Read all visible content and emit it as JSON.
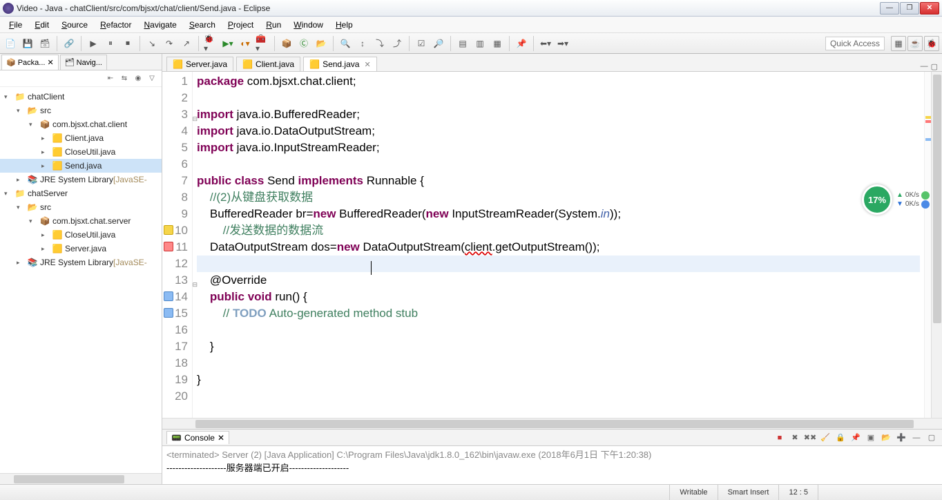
{
  "title": "Video - Java - chatClient/src/com/bjsxt/chat/client/Send.java - Eclipse",
  "menu": [
    "File",
    "Edit",
    "Source",
    "Refactor",
    "Navigate",
    "Search",
    "Project",
    "Run",
    "Window",
    "Help"
  ],
  "quick_access": "Quick Access",
  "sidebar": {
    "tabs": [
      {
        "label": "Packa...",
        "active": true
      },
      {
        "label": "Navig..."
      }
    ],
    "tree": [
      {
        "depth": 0,
        "exp": "▾",
        "icon": "proj",
        "label": "chatClient"
      },
      {
        "depth": 1,
        "exp": "▾",
        "icon": "src",
        "label": "src"
      },
      {
        "depth": 2,
        "exp": "▾",
        "icon": "pkg",
        "label": "com.bjsxt.chat.client"
      },
      {
        "depth": 3,
        "exp": "▸",
        "icon": "java",
        "label": "Client.java"
      },
      {
        "depth": 3,
        "exp": "▸",
        "icon": "java",
        "label": "CloseUtil.java"
      },
      {
        "depth": 3,
        "exp": "▸",
        "icon": "java",
        "label": "Send.java",
        "sel": true
      },
      {
        "depth": 1,
        "exp": "▸",
        "icon": "lib",
        "label": "JRE System Library",
        "suffix": "[JavaSE-"
      },
      {
        "depth": 0,
        "exp": "▾",
        "icon": "proj",
        "label": "chatServer"
      },
      {
        "depth": 1,
        "exp": "▾",
        "icon": "src",
        "label": "src"
      },
      {
        "depth": 2,
        "exp": "▾",
        "icon": "pkg",
        "label": "com.bjsxt.chat.server"
      },
      {
        "depth": 3,
        "exp": "▸",
        "icon": "java",
        "label": "CloseUtil.java"
      },
      {
        "depth": 3,
        "exp": "▸",
        "icon": "java",
        "label": "Server.java"
      },
      {
        "depth": 1,
        "exp": "▸",
        "icon": "lib",
        "label": "JRE System Library",
        "suffix": "[JavaSE-"
      }
    ]
  },
  "editor": {
    "tabs": [
      {
        "label": "Server.java",
        "active": false
      },
      {
        "label": "Client.java",
        "active": false
      },
      {
        "label": "Send.java",
        "active": true
      }
    ],
    "lines": [
      {
        "n": 1,
        "html": "<span class='kw'>package</span> com.bjsxt.chat.client;"
      },
      {
        "n": 2,
        "html": ""
      },
      {
        "n": 3,
        "html": "<span class='kw'>import</span> java.io.BufferedReader;",
        "fold": "-"
      },
      {
        "n": 4,
        "html": "<span class='kw'>import</span> java.io.DataOutputStream;"
      },
      {
        "n": 5,
        "html": "<span class='kw'>import</span> java.io.InputStreamReader;"
      },
      {
        "n": 6,
        "html": ""
      },
      {
        "n": 7,
        "html": "<span class='kw'>public</span> <span class='kw'>class</span> Send <span class='kw'>implements</span> Runnable {"
      },
      {
        "n": 8,
        "html": "    <span class='cm'>//(2)从键盘获取数据</span>"
      },
      {
        "n": 9,
        "html": "    BufferedReader br=<span class='kw'>new</span> BufferedReader(<span class='kw'>new</span> InputStreamReader(System.<span class='it'>in</span>));"
      },
      {
        "n": 10,
        "html": "        <span class='cm'>//发送数据的数据流</span>",
        "marker": "warn"
      },
      {
        "n": 11,
        "html": "    DataOutputStream dos=<span class='kw'>new</span> DataOutputStream(<span class='err'>client</span>.getOutputStream());",
        "marker": "err"
      },
      {
        "n": 12,
        "html": "",
        "cur": true
      },
      {
        "n": 13,
        "html": "    @Override",
        "fold": "-"
      },
      {
        "n": 14,
        "html": "    <span class='kw'>public</span> <span class='kw'>void</span> run() {",
        "marker": "info"
      },
      {
        "n": 15,
        "html": "        <span class='cm'>// </span><span class='todo'>TODO</span><span class='cm'> Auto-generated method stub</span>",
        "marker": "info"
      },
      {
        "n": 16,
        "html": ""
      },
      {
        "n": 17,
        "html": "    }"
      },
      {
        "n": 18,
        "html": ""
      },
      {
        "n": 19,
        "html": "}"
      },
      {
        "n": 20,
        "html": ""
      }
    ]
  },
  "console": {
    "tab": "Console",
    "term": "<terminated> Server (2) [Java Application] C:\\Program Files\\Java\\jdk1.8.0_162\\bin\\javaw.exe (2018年6月1日 下午1:20:38)",
    "line1": "--------------------服务器端已开启--------------------"
  },
  "status": {
    "writable": "Writable",
    "insert": "Smart Insert",
    "pos": "12 : 5"
  },
  "widget": {
    "percent": "17%",
    "up": "0K/s",
    "down": "0K/s"
  }
}
